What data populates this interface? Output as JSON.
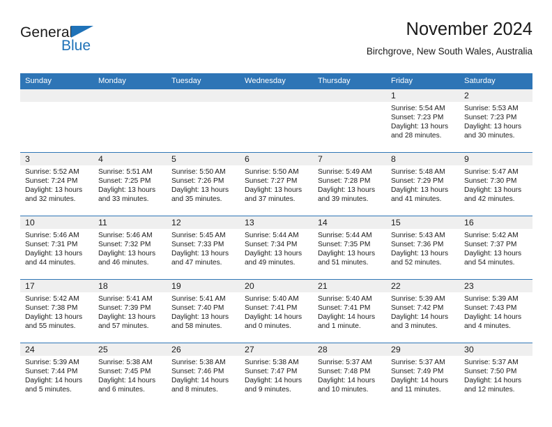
{
  "brand": {
    "name_part1": "General",
    "name_part2": "Blue",
    "triangle_color": "#1f72b8",
    "text_color": "#1a1a1a"
  },
  "header": {
    "title": "November 2024",
    "subtitle": "Birchgrove, New South Wales, Australia"
  },
  "theme": {
    "header_blue": "#2e75b6",
    "daynum_band": "#efefef",
    "cell_white": "#ffffff"
  },
  "calendar": {
    "weekday_headers": [
      "Sunday",
      "Monday",
      "Tuesday",
      "Wednesday",
      "Thursday",
      "Friday",
      "Saturday"
    ],
    "weeks": [
      [
        {
          "day": "",
          "empty": true,
          "sunrise": "",
          "sunset": "",
          "daylight": ""
        },
        {
          "day": "",
          "empty": true,
          "sunrise": "",
          "sunset": "",
          "daylight": ""
        },
        {
          "day": "",
          "empty": true,
          "sunrise": "",
          "sunset": "",
          "daylight": ""
        },
        {
          "day": "",
          "empty": true,
          "sunrise": "",
          "sunset": "",
          "daylight": ""
        },
        {
          "day": "",
          "empty": true,
          "sunrise": "",
          "sunset": "",
          "daylight": ""
        },
        {
          "day": "1",
          "empty": false,
          "sunrise": "Sunrise: 5:54 AM",
          "sunset": "Sunset: 7:23 PM",
          "daylight": "Daylight: 13 hours and 28 minutes."
        },
        {
          "day": "2",
          "empty": false,
          "sunrise": "Sunrise: 5:53 AM",
          "sunset": "Sunset: 7:23 PM",
          "daylight": "Daylight: 13 hours and 30 minutes."
        }
      ],
      [
        {
          "day": "3",
          "empty": false,
          "sunrise": "Sunrise: 5:52 AM",
          "sunset": "Sunset: 7:24 PM",
          "daylight": "Daylight: 13 hours and 32 minutes."
        },
        {
          "day": "4",
          "empty": false,
          "sunrise": "Sunrise: 5:51 AM",
          "sunset": "Sunset: 7:25 PM",
          "daylight": "Daylight: 13 hours and 33 minutes."
        },
        {
          "day": "5",
          "empty": false,
          "sunrise": "Sunrise: 5:50 AM",
          "sunset": "Sunset: 7:26 PM",
          "daylight": "Daylight: 13 hours and 35 minutes."
        },
        {
          "day": "6",
          "empty": false,
          "sunrise": "Sunrise: 5:50 AM",
          "sunset": "Sunset: 7:27 PM",
          "daylight": "Daylight: 13 hours and 37 minutes."
        },
        {
          "day": "7",
          "empty": false,
          "sunrise": "Sunrise: 5:49 AM",
          "sunset": "Sunset: 7:28 PM",
          "daylight": "Daylight: 13 hours and 39 minutes."
        },
        {
          "day": "8",
          "empty": false,
          "sunrise": "Sunrise: 5:48 AM",
          "sunset": "Sunset: 7:29 PM",
          "daylight": "Daylight: 13 hours and 41 minutes."
        },
        {
          "day": "9",
          "empty": false,
          "sunrise": "Sunrise: 5:47 AM",
          "sunset": "Sunset: 7:30 PM",
          "daylight": "Daylight: 13 hours and 42 minutes."
        }
      ],
      [
        {
          "day": "10",
          "empty": false,
          "sunrise": "Sunrise: 5:46 AM",
          "sunset": "Sunset: 7:31 PM",
          "daylight": "Daylight: 13 hours and 44 minutes."
        },
        {
          "day": "11",
          "empty": false,
          "sunrise": "Sunrise: 5:46 AM",
          "sunset": "Sunset: 7:32 PM",
          "daylight": "Daylight: 13 hours and 46 minutes."
        },
        {
          "day": "12",
          "empty": false,
          "sunrise": "Sunrise: 5:45 AM",
          "sunset": "Sunset: 7:33 PM",
          "daylight": "Daylight: 13 hours and 47 minutes."
        },
        {
          "day": "13",
          "empty": false,
          "sunrise": "Sunrise: 5:44 AM",
          "sunset": "Sunset: 7:34 PM",
          "daylight": "Daylight: 13 hours and 49 minutes."
        },
        {
          "day": "14",
          "empty": false,
          "sunrise": "Sunrise: 5:44 AM",
          "sunset": "Sunset: 7:35 PM",
          "daylight": "Daylight: 13 hours and 51 minutes."
        },
        {
          "day": "15",
          "empty": false,
          "sunrise": "Sunrise: 5:43 AM",
          "sunset": "Sunset: 7:36 PM",
          "daylight": "Daylight: 13 hours and 52 minutes."
        },
        {
          "day": "16",
          "empty": false,
          "sunrise": "Sunrise: 5:42 AM",
          "sunset": "Sunset: 7:37 PM",
          "daylight": "Daylight: 13 hours and 54 minutes."
        }
      ],
      [
        {
          "day": "17",
          "empty": false,
          "sunrise": "Sunrise: 5:42 AM",
          "sunset": "Sunset: 7:38 PM",
          "daylight": "Daylight: 13 hours and 55 minutes."
        },
        {
          "day": "18",
          "empty": false,
          "sunrise": "Sunrise: 5:41 AM",
          "sunset": "Sunset: 7:39 PM",
          "daylight": "Daylight: 13 hours and 57 minutes."
        },
        {
          "day": "19",
          "empty": false,
          "sunrise": "Sunrise: 5:41 AM",
          "sunset": "Sunset: 7:40 PM",
          "daylight": "Daylight: 13 hours and 58 minutes."
        },
        {
          "day": "20",
          "empty": false,
          "sunrise": "Sunrise: 5:40 AM",
          "sunset": "Sunset: 7:41 PM",
          "daylight": "Daylight: 14 hours and 0 minutes."
        },
        {
          "day": "21",
          "empty": false,
          "sunrise": "Sunrise: 5:40 AM",
          "sunset": "Sunset: 7:41 PM",
          "daylight": "Daylight: 14 hours and 1 minute."
        },
        {
          "day": "22",
          "empty": false,
          "sunrise": "Sunrise: 5:39 AM",
          "sunset": "Sunset: 7:42 PM",
          "daylight": "Daylight: 14 hours and 3 minutes."
        },
        {
          "day": "23",
          "empty": false,
          "sunrise": "Sunrise: 5:39 AM",
          "sunset": "Sunset: 7:43 PM",
          "daylight": "Daylight: 14 hours and 4 minutes."
        }
      ],
      [
        {
          "day": "24",
          "empty": false,
          "sunrise": "Sunrise: 5:39 AM",
          "sunset": "Sunset: 7:44 PM",
          "daylight": "Daylight: 14 hours and 5 minutes."
        },
        {
          "day": "25",
          "empty": false,
          "sunrise": "Sunrise: 5:38 AM",
          "sunset": "Sunset: 7:45 PM",
          "daylight": "Daylight: 14 hours and 6 minutes."
        },
        {
          "day": "26",
          "empty": false,
          "sunrise": "Sunrise: 5:38 AM",
          "sunset": "Sunset: 7:46 PM",
          "daylight": "Daylight: 14 hours and 8 minutes."
        },
        {
          "day": "27",
          "empty": false,
          "sunrise": "Sunrise: 5:38 AM",
          "sunset": "Sunset: 7:47 PM",
          "daylight": "Daylight: 14 hours and 9 minutes."
        },
        {
          "day": "28",
          "empty": false,
          "sunrise": "Sunrise: 5:37 AM",
          "sunset": "Sunset: 7:48 PM",
          "daylight": "Daylight: 14 hours and 10 minutes."
        },
        {
          "day": "29",
          "empty": false,
          "sunrise": "Sunrise: 5:37 AM",
          "sunset": "Sunset: 7:49 PM",
          "daylight": "Daylight: 14 hours and 11 minutes."
        },
        {
          "day": "30",
          "empty": false,
          "sunrise": "Sunrise: 5:37 AM",
          "sunset": "Sunset: 7:50 PM",
          "daylight": "Daylight: 14 hours and 12 minutes."
        }
      ]
    ]
  }
}
